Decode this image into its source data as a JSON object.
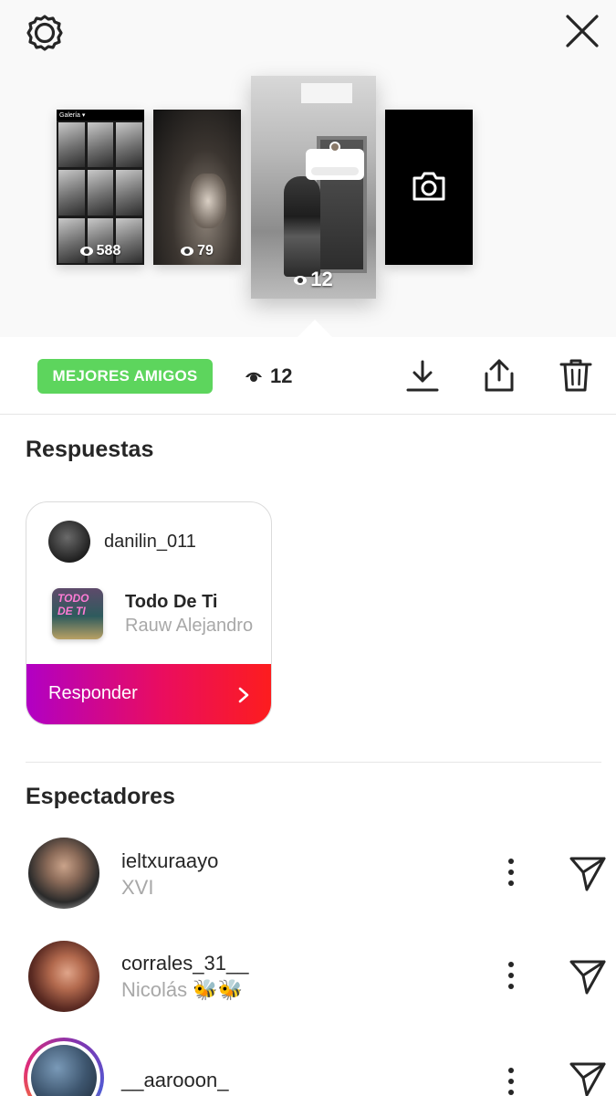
{
  "header": {
    "settings_icon": "gear-icon",
    "close_icon": "close-icon"
  },
  "stories": [
    {
      "views": "588"
    },
    {
      "views": "79"
    },
    {
      "views": "12",
      "selected": true
    },
    {
      "type": "camera",
      "icon": "camera-icon"
    }
  ],
  "toolbar": {
    "badge": "MEJORES AMIGOS",
    "badge_color": "#5dd55d",
    "view_count": "12",
    "icons": [
      "download-icon",
      "share-icon",
      "trash-icon"
    ]
  },
  "replies": {
    "title": "Respuestas",
    "card": {
      "username": "danilin_011",
      "song_title": "Todo De Ti",
      "artist": "Rauw Alejandro",
      "cover_text": "TODO DE TI",
      "reply_label": "Responder"
    }
  },
  "viewers": {
    "title": "Espectadores",
    "items": [
      {
        "username": "ieltxuraayo",
        "name": "XVI"
      },
      {
        "username": "corrales_31__",
        "name": "Nicolás 🐝🐝"
      },
      {
        "username": "__aarooon_",
        "name": ""
      }
    ]
  }
}
